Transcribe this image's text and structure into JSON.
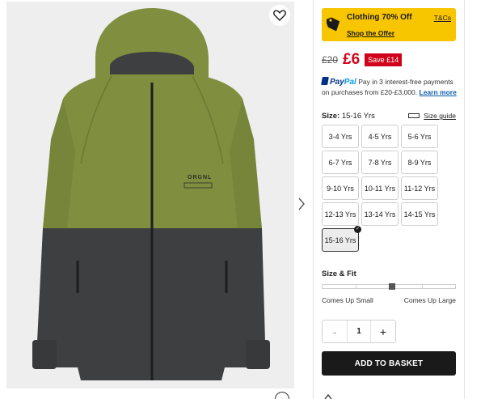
{
  "product_image": {
    "alt": "Khaki and charcoal colour block zip-up hooded jacket",
    "logo_text": "ORGNL",
    "logo_subtext": "ORIGINAL"
  },
  "offer": {
    "title": "Clothing 70% Off",
    "link": "Shop the Offer",
    "terms": "T&Cs"
  },
  "price": {
    "was": "£20",
    "now": "£6",
    "save": "Save  £14"
  },
  "paypal": {
    "brand_pay": "Pay",
    "brand_pal": "Pal",
    "text": "Pay in 3 interest-free payments on purchases from £20-£3,000.",
    "learn_more": "Learn more"
  },
  "size": {
    "label": "Size:",
    "selected": "15-16 Yrs",
    "guide": "Size guide",
    "options": [
      "3-4 Yrs",
      "4-5 Yrs",
      "5-6 Yrs",
      "6-7 Yrs",
      "7-8 Yrs",
      "8-9 Yrs",
      "9-10 Yrs",
      "10-11 Yrs",
      "11-12 Yrs",
      "12-13 Yrs",
      "13-14 Yrs",
      "14-15 Yrs",
      "15-16 Yrs"
    ]
  },
  "fit": {
    "label": "Size & Fit",
    "low": "Comes Up Small",
    "high": "Comes Up Large",
    "segments": 4,
    "position": 0.5
  },
  "quantity": {
    "minus": "-",
    "value": "1",
    "plus": "+"
  },
  "add_to_basket": "ADD TO BASKET",
  "colors": {
    "offer_bg": "#f7c600",
    "price_red": "#d0021b",
    "button_dark": "#1a1a1a",
    "jacket_khaki": "#7f8f3f",
    "jacket_charcoal": "#3d3f40"
  },
  "icons": {
    "wishlist": "heart-icon",
    "next": "chevron-right-icon",
    "offer": "tag-icon",
    "size_guide": "ruler-icon",
    "selected": "check-icon",
    "zoom": "zoom-icon"
  }
}
